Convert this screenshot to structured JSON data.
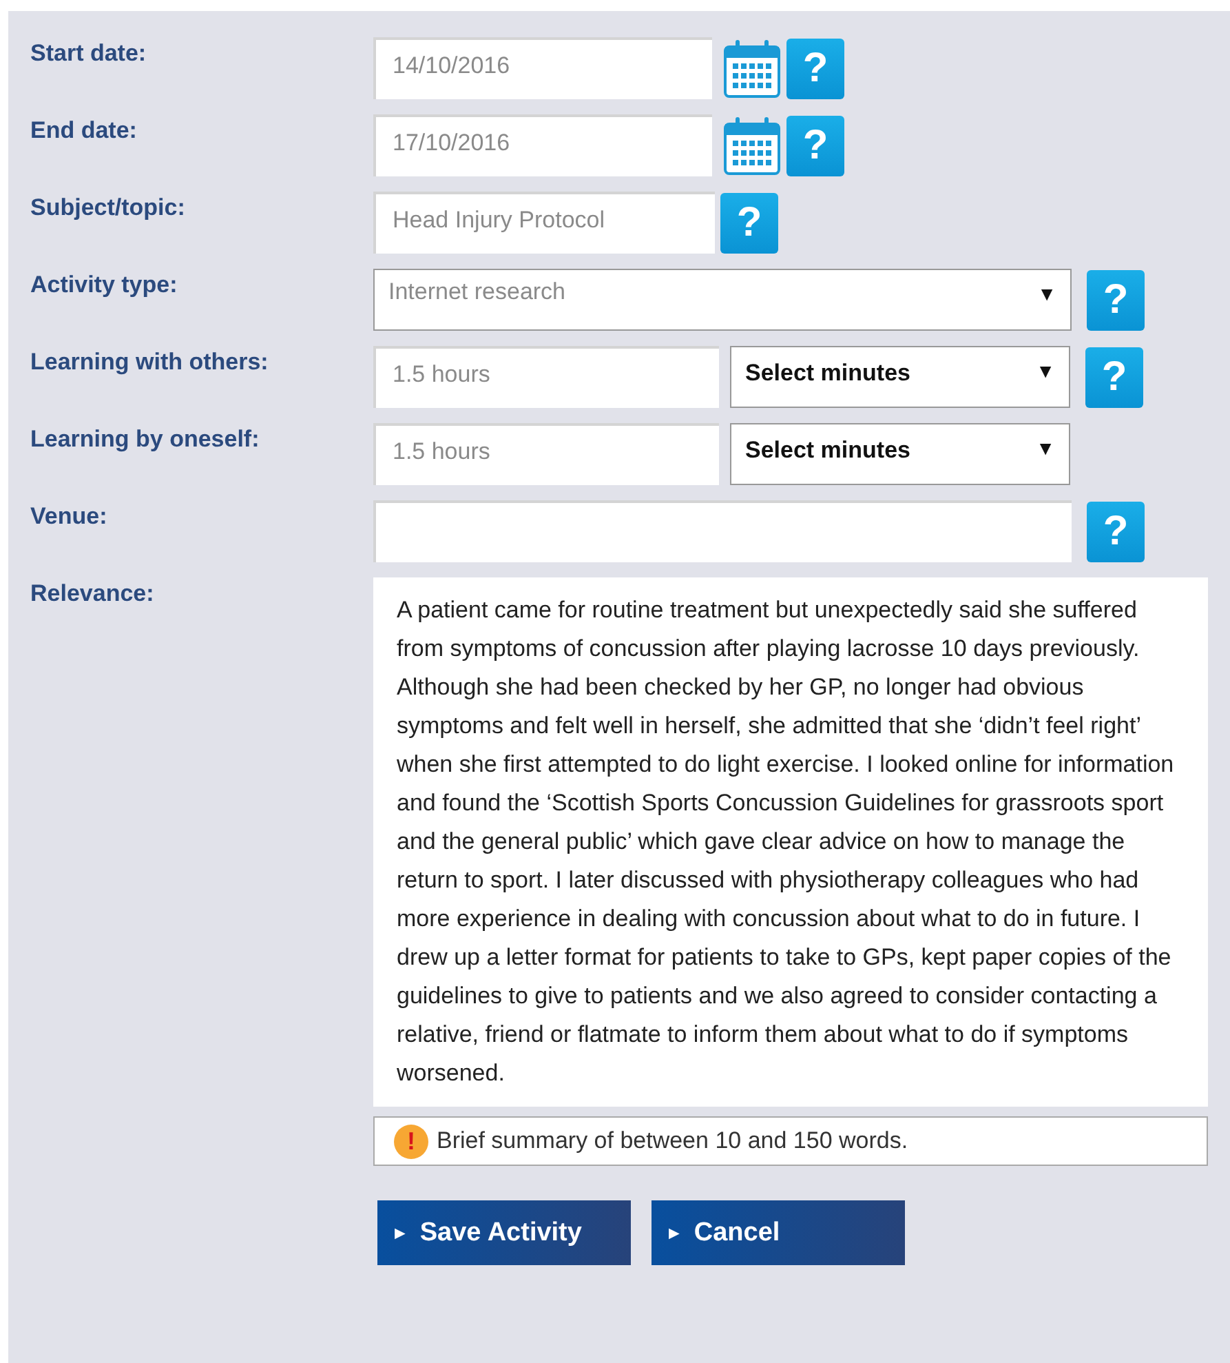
{
  "rows": [
    {
      "kind": "date",
      "label": "Start date:",
      "value": "14/10/2016",
      "help": "?"
    },
    {
      "kind": "date",
      "label": "End date:",
      "value": "17/10/2016",
      "help": "?"
    },
    {
      "kind": "text",
      "label": "Subject/topic:",
      "value": "Head Injury Protocol",
      "help": "?"
    },
    {
      "kind": "select",
      "label": "Activity type:",
      "value": "Internet research",
      "arrow": "▼",
      "help": "?"
    },
    {
      "kind": "duration",
      "label": "Learning with others:",
      "value": "1.5 hours",
      "select": "Select minutes",
      "arrow": "▼",
      "help": "?"
    },
    {
      "kind": "duration",
      "label": "Learning by oneself:",
      "value": "1.5 hours",
      "select": "Select minutes",
      "arrow": "▼"
    },
    {
      "kind": "venue",
      "label": "Venue:",
      "help": "?"
    }
  ],
  "relevance": {
    "label": "Relevance:",
    "value": "A patient came for routine treatment but unexpectedly said she suffered from symptoms of concussion after playing lacrosse 10 days previously. Although she had been checked by her GP, no longer had obvious symptoms and felt well in herself, she admitted that she ‘didn’t feel right’ when she first attempted to do light exercise. I looked online for information and found the ‘Scottish Sports Concussion Guidelines for grassroots sport and the general public’ which gave clear advice on how to manage the return to sport. I later discussed with physiotherapy colleagues who had more experience in dealing with concussion about what to do in future. I drew up a letter format for patients to take to GPs, kept paper copies of the guidelines to give to patients and we also agreed to consider contacting a relative, friend or flatmate to inform them about what to do if symptoms worsened.",
    "note": "Brief summary of between 10 and 150 words.",
    "note_icon": "!"
  },
  "buttons": [
    {
      "label": "Save Activity",
      "icon": "►"
    },
    {
      "label": "Cancel",
      "icon": "►"
    }
  ]
}
